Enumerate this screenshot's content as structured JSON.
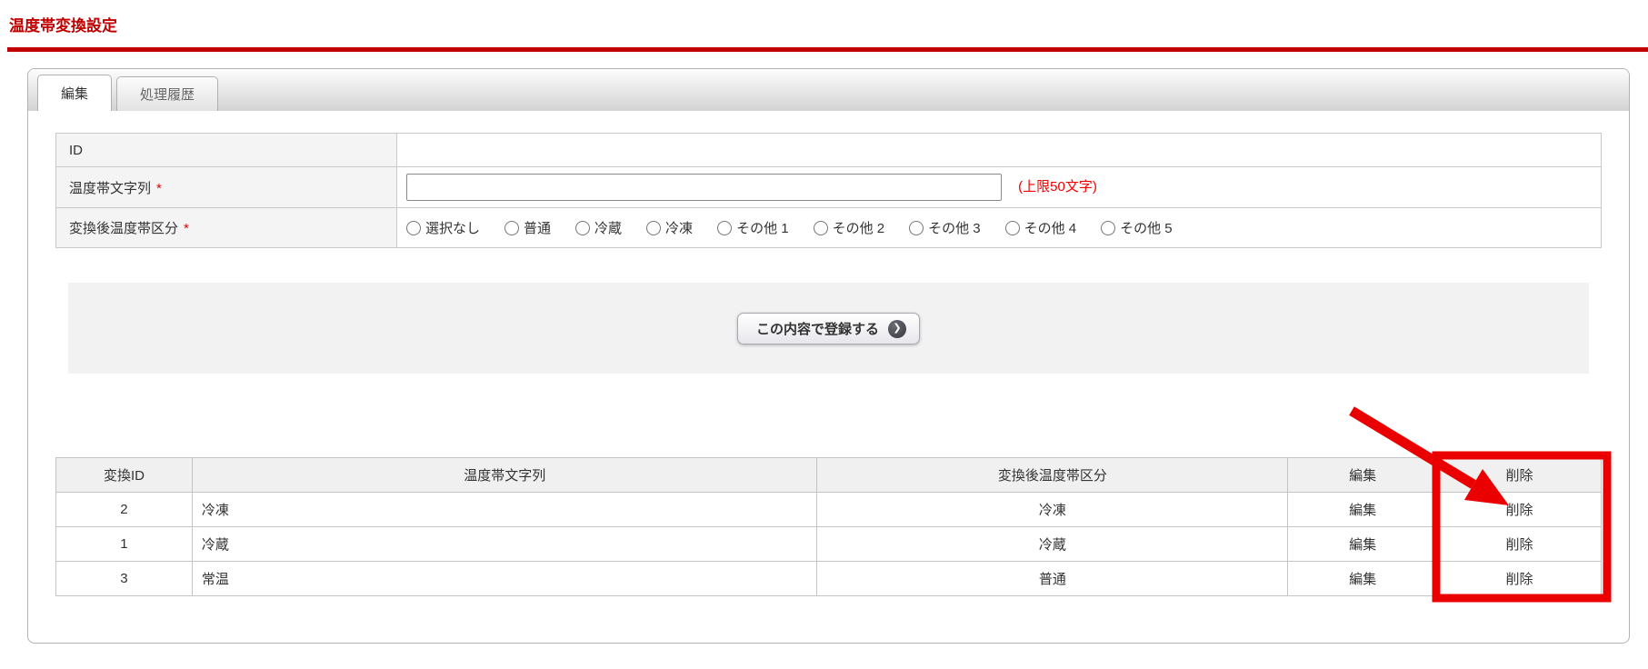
{
  "page": {
    "title": "温度帯変換設定"
  },
  "tabs": [
    {
      "label": "編集",
      "active": true
    },
    {
      "label": "処理履歴",
      "active": false
    }
  ],
  "form": {
    "required_mark": "*",
    "rows": [
      {
        "label": "ID",
        "required": false,
        "value": ""
      },
      {
        "label": "温度帯文字列",
        "required": true,
        "input_value": "",
        "input_placeholder": "",
        "note": "(上限50文字)"
      },
      {
        "label": "変換後温度帯区分",
        "required": true
      }
    ],
    "radio_options": [
      "選択なし",
      "普通",
      "冷蔵",
      "冷凍",
      "その他 1",
      "その他 2",
      "その他 3",
      "その他 4",
      "その他 5"
    ]
  },
  "submit": {
    "label": "この内容で登録する",
    "icon": "❯"
  },
  "table": {
    "headers": [
      "変換ID",
      "温度帯文字列",
      "変換後温度帯区分",
      "編集",
      "削除"
    ],
    "rows": [
      {
        "id": "2",
        "string": "冷凍",
        "category": "冷凍",
        "edit": "編集",
        "delete": "削除"
      },
      {
        "id": "1",
        "string": "冷蔵",
        "category": "冷蔵",
        "edit": "編集",
        "delete": "削除"
      },
      {
        "id": "3",
        "string": "常温",
        "category": "普通",
        "edit": "編集",
        "delete": "削除"
      }
    ]
  },
  "annotation": {
    "color": "#ea0000",
    "highlight_target": "delete-column"
  },
  "colors": {
    "title_red": "#c00000",
    "note_red": "#f20000",
    "label_bg": "#f4f4f4",
    "header_bg": "#f0f0f0",
    "band_bg": "#f2f2f3"
  }
}
